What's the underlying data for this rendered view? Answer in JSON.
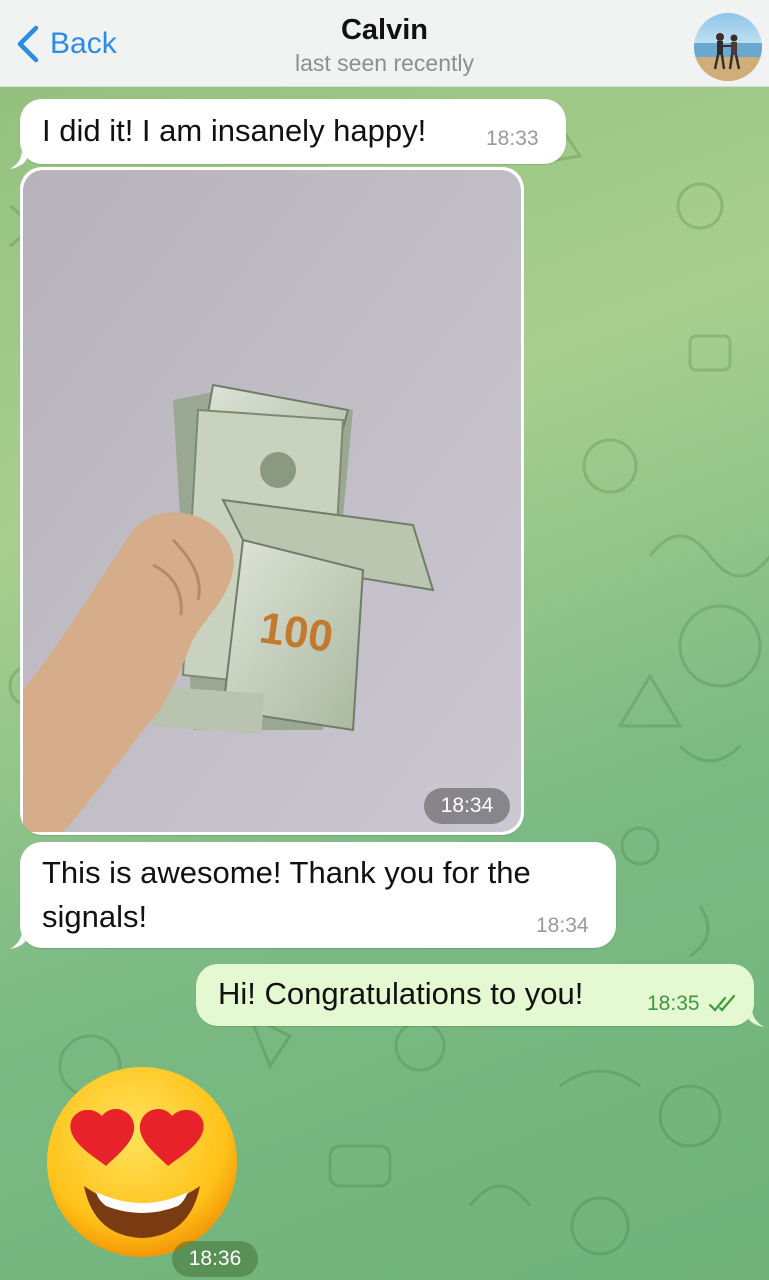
{
  "header": {
    "back_label": "Back",
    "title": "Calvin",
    "status": "last seen recently"
  },
  "messages": [
    {
      "direction": "incoming",
      "type": "text",
      "text": "I did it! I am insanely happy!",
      "time": "18:33"
    },
    {
      "direction": "incoming",
      "type": "photo",
      "time": "18:34"
    },
    {
      "direction": "incoming",
      "type": "text",
      "lines": [
        "This is awesome! Thank you for the",
        "signals!"
      ],
      "time": "18:34"
    },
    {
      "direction": "outgoing",
      "type": "text",
      "text": "Hi! Congratulations to you!",
      "time": "18:35",
      "status": "read"
    },
    {
      "direction": "incoming",
      "type": "sticker",
      "sticker": "heart-eyes-emoji",
      "time": "18:36"
    }
  ],
  "colors": {
    "accent": "#2b8ce6",
    "outgoing_bubble": "#e4f8d1",
    "incoming_bubble": "#ffffff",
    "outgoing_time": "#3d9a3c"
  },
  "icons": [
    "chevron-left-icon",
    "double-check-icon"
  ]
}
